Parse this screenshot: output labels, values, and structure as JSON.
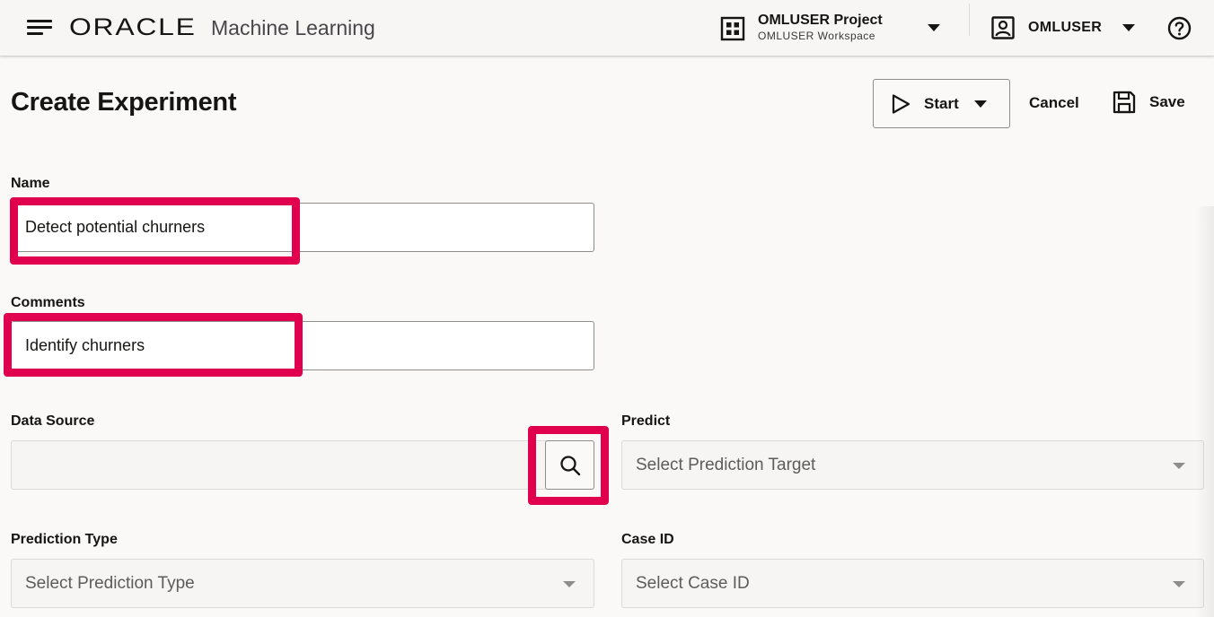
{
  "header": {
    "brand": "ORACLE",
    "product": "Machine Learning",
    "project_name": "OMLUSER Project",
    "workspace_name": "OMLUSER Workspace",
    "user_name": "OMLUSER"
  },
  "page": {
    "title": "Create Experiment"
  },
  "toolbar": {
    "start_label": "Start",
    "cancel_label": "Cancel",
    "save_label": "Save"
  },
  "form": {
    "name": {
      "label": "Name",
      "value": "Detect potential churners"
    },
    "comments": {
      "label": "Comments",
      "value": "Identify churners"
    },
    "data_source": {
      "label": "Data Source",
      "value": ""
    },
    "predict": {
      "label": "Predict",
      "placeholder": "Select Prediction Target"
    },
    "prediction_type": {
      "label": "Prediction Type",
      "placeholder": "Select Prediction Type"
    },
    "case_id": {
      "label": "Case ID",
      "placeholder": "Select Case ID"
    }
  },
  "colors": {
    "highlight": "#e0004d",
    "background": "#faf9f7"
  },
  "icons": [
    "hamburger-icon",
    "grid-icon",
    "chevron-down-icon",
    "user-icon",
    "help-icon",
    "play-icon",
    "save-icon",
    "search-icon"
  ]
}
